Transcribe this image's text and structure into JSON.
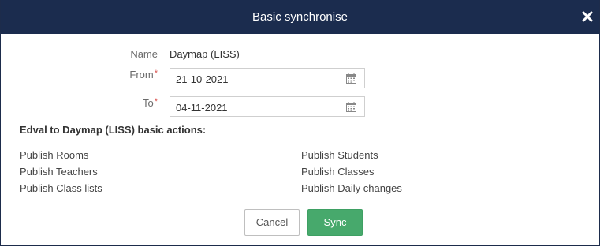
{
  "dialog": {
    "title": "Basic synchronise",
    "close_icon": "close-icon"
  },
  "form": {
    "name_label": "Name",
    "name_value": "Daymap (LISS)",
    "from_label": "From",
    "from_value": "21-10-2021",
    "to_label": "To",
    "to_value": "04-11-2021",
    "required_mark": "*",
    "calendar_icon": "calendar-icon"
  },
  "actions": {
    "title": "Edval to Daymap (LISS) basic actions:",
    "left": [
      "Publish Rooms",
      "Publish Teachers",
      "Publish Class lists"
    ],
    "right": [
      "Publish Students",
      "Publish Classes",
      "Publish Daily changes"
    ]
  },
  "buttons": {
    "cancel_label": "Cancel",
    "sync_label": "Sync"
  },
  "colors": {
    "header_bg": "#1b2c4e",
    "sync_button": "#47a96c",
    "required": "#d9534f"
  }
}
